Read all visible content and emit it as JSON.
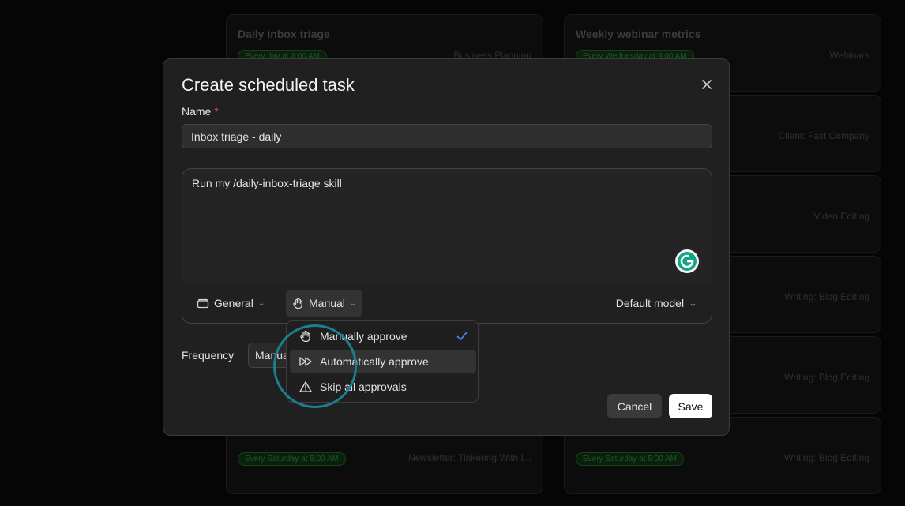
{
  "background_cards": [
    {
      "title": "Daily inbox triage",
      "schedule": "Every day at 4:00 AM",
      "tag": "Business Planning"
    },
    {
      "title": "Weekly webinar metrics",
      "schedule": "Every Wednesday at 9:00 AM",
      "tag": "Webinars"
    },
    {
      "title": "",
      "schedule": "",
      "tag": "Client: Fast Company"
    },
    {
      "title": "",
      "schedule": "",
      "tag": "Video Editing"
    },
    {
      "title": "",
      "schedule": "",
      "tag": "Writing: Blog Editing"
    },
    {
      "title": "",
      "schedule": "",
      "tag": "Writing: Blog Editing"
    },
    {
      "title": "",
      "schedule": "Every Saturday at 5:00 AM",
      "tag": "Newsletter: Tinkering With I..."
    },
    {
      "title": "",
      "schedule": "Every Saturday at 5:00 AM",
      "tag": "Writing: Blog Editing"
    }
  ],
  "modal": {
    "title": "Create scheduled task",
    "name_label": "Name",
    "required_mark": "*",
    "name_value": "Inbox triage - daily",
    "prompt_text": "Run my /daily-inbox-triage skill",
    "project_label": "General",
    "approval_label": "Manual",
    "model_label": "Default model",
    "frequency_label": "Frequency",
    "frequency_value": "Manual",
    "cancel_label": "Cancel",
    "save_label": "Save"
  },
  "approval_menu": {
    "items": [
      {
        "label": "Manually approve",
        "icon": "hand-icon",
        "selected": true
      },
      {
        "label": "Automatically approve",
        "icon": "fast-forward-icon",
        "selected": false
      },
      {
        "label": "Skip all approvals",
        "icon": "warning-icon",
        "selected": false
      }
    ]
  },
  "colors": {
    "accent_check": "#4a8cf7",
    "highlight_ring": "#1b7f8f",
    "required": "#e05050"
  }
}
